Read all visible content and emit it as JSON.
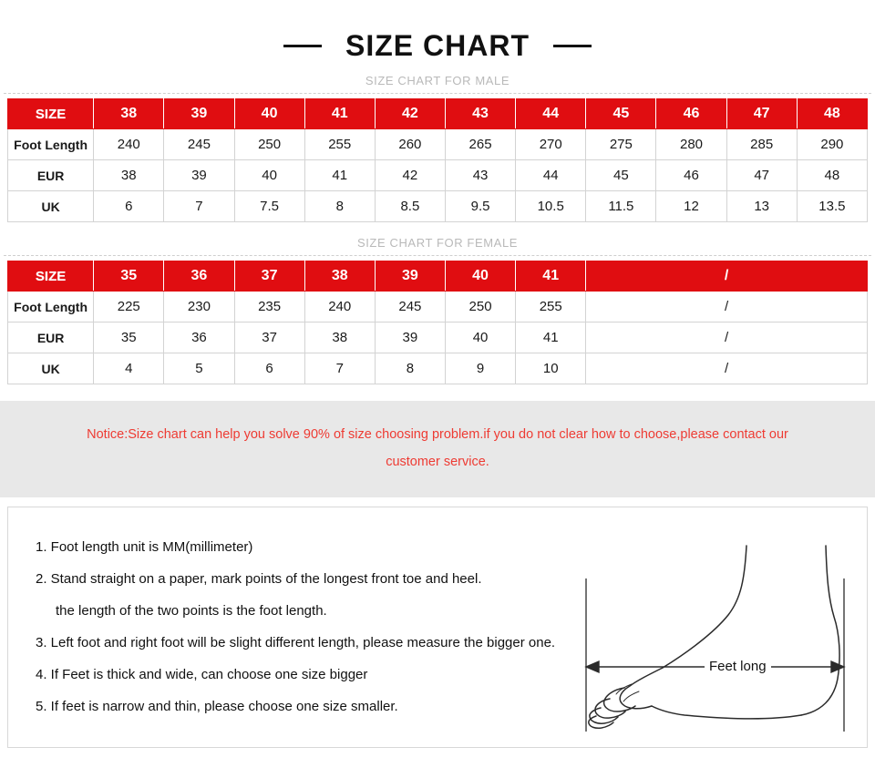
{
  "header": {
    "title": "SIZE CHART"
  },
  "male_section": {
    "subtitle": "SIZE CHART FOR MALE",
    "table": {
      "header": [
        "SIZE",
        "38",
        "39",
        "40",
        "41",
        "42",
        "43",
        "44",
        "45",
        "46",
        "47",
        "48"
      ],
      "rows": [
        {
          "label": "Foot Length",
          "values": [
            "240",
            "245",
            "250",
            "255",
            "260",
            "265",
            "270",
            "275",
            "280",
            "285",
            "290"
          ]
        },
        {
          "label": "EUR",
          "values": [
            "38",
            "39",
            "40",
            "41",
            "42",
            "43",
            "44",
            "45",
            "46",
            "47",
            "48"
          ]
        },
        {
          "label": "UK",
          "values": [
            "6",
            "7",
            "7.5",
            "8",
            "8.5",
            "9.5",
            "10.5",
            "11.5",
            "12",
            "13",
            "13.5"
          ]
        }
      ]
    }
  },
  "female_section": {
    "subtitle": "SIZE CHART FOR FEMALE",
    "table": {
      "header": [
        "SIZE",
        "35",
        "36",
        "37",
        "38",
        "39",
        "40",
        "41"
      ],
      "header_merged": "/",
      "rows": [
        {
          "label": "Foot Length",
          "values": [
            "225",
            "230",
            "235",
            "240",
            "245",
            "250",
            "255"
          ],
          "merged": "/"
        },
        {
          "label": "EUR",
          "values": [
            "35",
            "36",
            "37",
            "38",
            "39",
            "40",
            "41"
          ],
          "merged": "/"
        },
        {
          "label": "UK",
          "values": [
            "4",
            "5",
            "6",
            "7",
            "8",
            "9",
            "10"
          ],
          "merged": "/"
        }
      ]
    }
  },
  "notice": {
    "line1": "Notice:Size chart can help you solve 90% of size choosing problem.if you do not clear how to choose,please contact our",
    "line2": "customer service."
  },
  "instructions": {
    "items": [
      "1. Foot length unit is MM(millimeter)",
      "2. Stand straight on a paper, mark points of the longest front toe and heel.",
      "the length of the two points is the foot length.",
      "3. Left foot and right foot will be slight different length, please measure the bigger one.",
      "4. If Feet is thick and wide, can choose one size bigger",
      "5. If feet is narrow and thin, please choose one size smaller."
    ]
  },
  "diagram": {
    "measure_label": "Feet long"
  },
  "colors": {
    "red": "#e00d11",
    "notice_red": "#ee3b33",
    "notice_bg": "#e8e8e8",
    "subtitle_gray": "#b9b9b9",
    "border_gray": "#d3d3d3"
  }
}
